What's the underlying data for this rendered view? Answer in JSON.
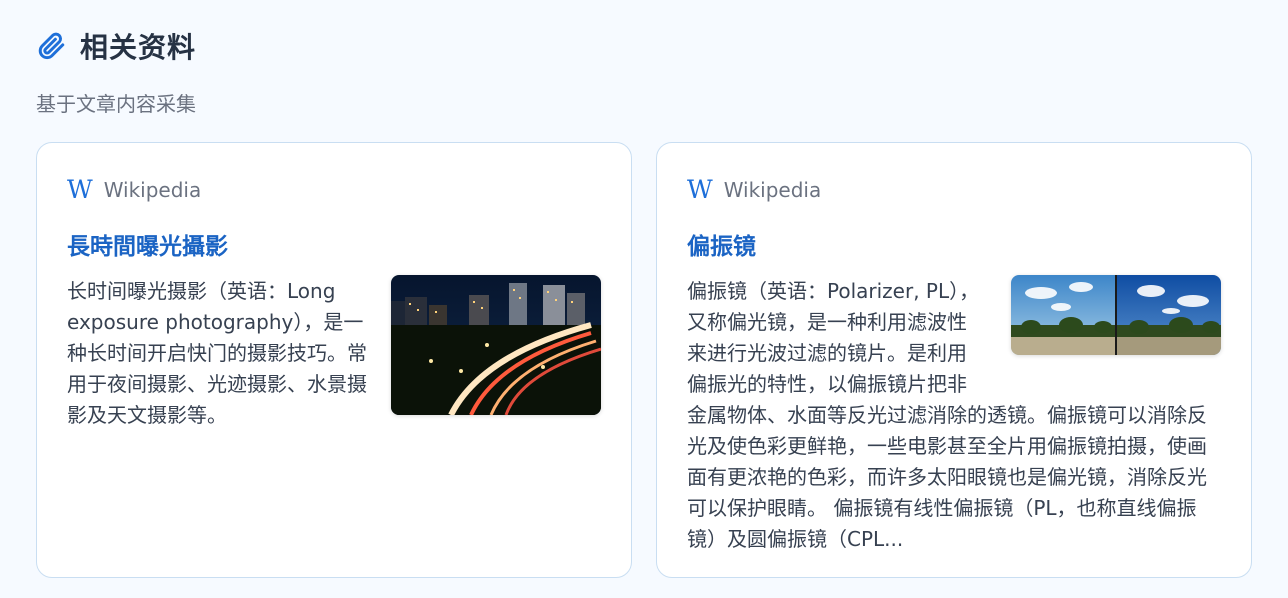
{
  "header": {
    "title": "相关资料",
    "subtitle": "基于文章内容采集",
    "icon": "paperclip-icon",
    "accent": "#1e6fd9"
  },
  "cards": [
    {
      "source_icon": "wikipedia-icon",
      "source_icon_glyph": "W",
      "source": "Wikipedia",
      "title": "長時間曝光攝影",
      "image": "night-highway-long-exposure-photo",
      "text": "长时间曝光摄影（英语：Long exposure photography），是一种长时间开启快门的摄影技巧。常用于夜间摄影、光迹摄影、水景摄影及天文摄影等。"
    },
    {
      "source_icon": "wikipedia-icon",
      "source_icon_glyph": "W",
      "source": "Wikipedia",
      "title": "偏振镜",
      "image": "polarizer-comparison-photo",
      "text": "偏振镜（英语：Polarizer, PL），又称偏光镜，是一种利用滤波性来进行光波过滤的镜片。是利用偏振光的特性，以偏振镜片把非金属物体、水面等反光过滤消除的透镜。偏振镜可以消除反光及使色彩更鲜艳，一些电影甚至全片用偏振镜拍摄，使画面有更浓艳的色彩，而许多太阳眼镜也是偏光镜，消除反光可以保护眼睛。 偏振镜有线性偏振镜（PL，也称直线偏振镜）及圆偏振镜（CPL..."
    }
  ]
}
